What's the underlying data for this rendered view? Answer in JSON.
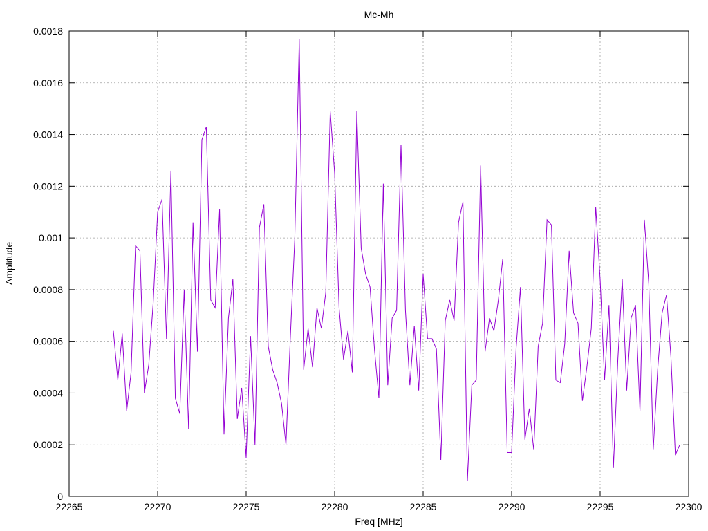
{
  "chart_data": {
    "type": "line",
    "title": "Mc-Mh",
    "xlabel": "Freq [MHz]",
    "ylabel": "Amplitude",
    "xlim": [
      22265,
      22300
    ],
    "ylim": [
      0,
      0.0018
    ],
    "grid": true,
    "legend": "none",
    "xticks": [
      "22265",
      "22270",
      "22275",
      "22280",
      "22285",
      "22290",
      "22295",
      "22300"
    ],
    "yticks": [
      "0",
      "0.0002",
      "0.0004",
      "0.0006",
      "0.0008",
      "0.001",
      "0.0012",
      "0.0014",
      "0.0016",
      "0.0018"
    ],
    "series": [
      {
        "color": "#9400d3",
        "x": [
          22267.5,
          22267.75,
          22268.0,
          22268.25,
          22268.5,
          22268.75,
          22269.0,
          22269.25,
          22269.5,
          22269.75,
          22270.0,
          22270.25,
          22270.5,
          22270.75,
          22271.0,
          22271.25,
          22271.5,
          22271.75,
          22272.0,
          22272.25,
          22272.5,
          22272.75,
          22273.0,
          22273.25,
          22273.5,
          22273.75,
          22274.0,
          22274.25,
          22274.5,
          22274.75,
          22275.0,
          22275.25,
          22275.5,
          22275.75,
          22276.0,
          22276.25,
          22276.5,
          22276.75,
          22277.0,
          22277.25,
          22277.5,
          22277.75,
          22278.0,
          22278.25,
          22278.5,
          22278.75,
          22279.0,
          22279.25,
          22279.5,
          22279.75,
          22280.0,
          22280.25,
          22280.5,
          22280.75,
          22281.0,
          22281.25,
          22281.5,
          22281.75,
          22282.0,
          22282.25,
          22282.5,
          22282.75,
          22283.0,
          22283.25,
          22283.5,
          22283.75,
          22284.0,
          22284.25,
          22284.5,
          22284.75,
          22285.0,
          22285.25,
          22285.5,
          22285.75,
          22286.0,
          22286.25,
          22286.5,
          22286.75,
          22287.0,
          22287.25,
          22287.5,
          22287.75,
          22288.0,
          22288.25,
          22288.5,
          22288.75,
          22289.0,
          22289.25,
          22289.5,
          22289.75,
          22290.0,
          22290.25,
          22290.5,
          22290.75,
          22291.0,
          22291.25,
          22291.5,
          22291.75,
          22292.0,
          22292.25,
          22292.5,
          22292.75,
          22293.0,
          22293.25,
          22293.5,
          22293.75,
          22294.0,
          22294.25,
          22294.5,
          22294.75,
          22295.0,
          22295.25,
          22295.5,
          22295.75,
          22296.0,
          22296.25,
          22296.5,
          22296.75,
          22297.0,
          22297.25,
          22297.5,
          22297.75,
          22298.0,
          22298.25,
          22298.5,
          22298.75,
          22299.0,
          22299.25,
          22299.5
        ],
        "y": [
          0.00064,
          0.00045,
          0.00063,
          0.00033,
          0.00048,
          0.00097,
          0.00095,
          0.0004,
          0.00051,
          0.00075,
          0.0011,
          0.00115,
          0.00061,
          0.00126,
          0.00038,
          0.00032,
          0.0008,
          0.00026,
          0.00106,
          0.00056,
          0.00138,
          0.00143,
          0.00076,
          0.00073,
          0.00111,
          0.00024,
          0.00069,
          0.00084,
          0.0003,
          0.00042,
          0.00015,
          0.00062,
          0.0002,
          0.00104,
          0.00113,
          0.00058,
          0.00049,
          0.00044,
          0.00036,
          0.0002,
          0.00062,
          0.001,
          0.00177,
          0.00049,
          0.00065,
          0.0005,
          0.00073,
          0.00065,
          0.00079,
          0.00149,
          0.00125,
          0.00073,
          0.00053,
          0.00064,
          0.00048,
          0.00149,
          0.00096,
          0.00086,
          0.00081,
          0.00057,
          0.00038,
          0.00121,
          0.00043,
          0.00069,
          0.00072,
          0.00136,
          0.00072,
          0.00043,
          0.00066,
          0.00041,
          0.00086,
          0.00061,
          0.00061,
          0.00057,
          0.00014,
          0.00068,
          0.00076,
          0.00068,
          0.00106,
          0.00114,
          6e-05,
          0.00043,
          0.00045,
          0.00128,
          0.00056,
          0.00069,
          0.00064,
          0.00076,
          0.00092,
          0.00017,
          0.00017,
          0.00057,
          0.00081,
          0.00022,
          0.00034,
          0.00018,
          0.00058,
          0.00067,
          0.00107,
          0.00105,
          0.00045,
          0.00044,
          0.00059,
          0.00095,
          0.00071,
          0.00067,
          0.00037,
          0.0005,
          0.00065,
          0.00112,
          0.00084,
          0.00045,
          0.00074,
          0.00011,
          0.00053,
          0.00084,
          0.00041,
          0.00069,
          0.00074,
          0.00033,
          0.00107,
          0.00082,
          0.00018,
          0.00049,
          0.00071,
          0.00078,
          0.00054,
          0.00016,
          0.0002
        ]
      }
    ]
  }
}
